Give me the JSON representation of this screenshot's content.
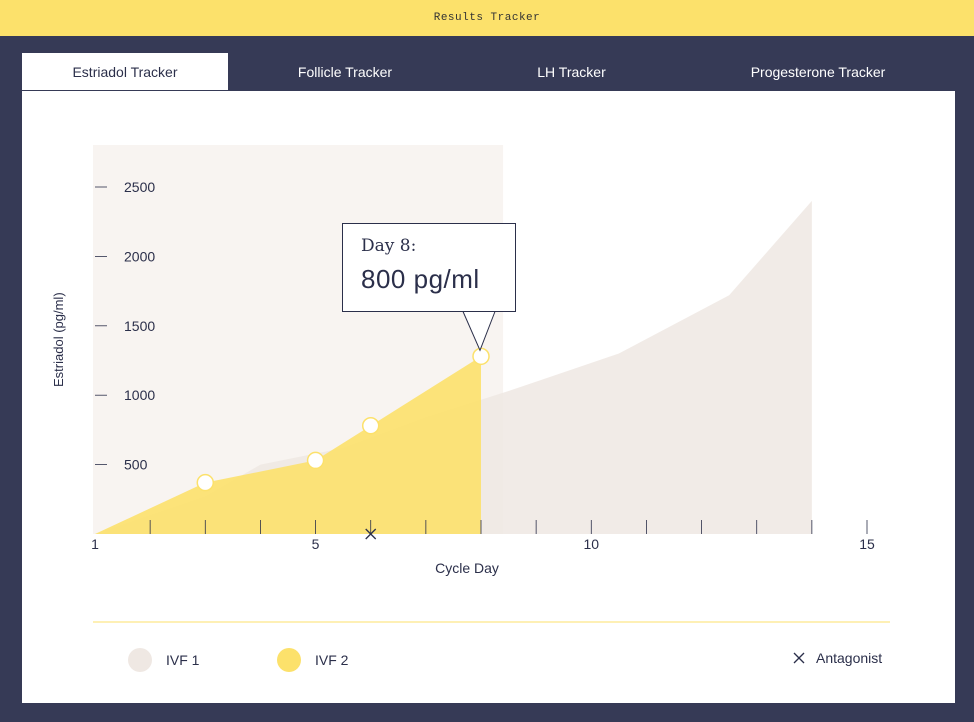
{
  "app": {
    "title": "Results Tracker"
  },
  "tabs": [
    {
      "label": "Estriadol Tracker",
      "active": true
    },
    {
      "label": "Follicle Tracker",
      "active": false
    },
    {
      "label": "LH Tracker",
      "active": false
    },
    {
      "label": "Progesterone Tracker",
      "active": false
    }
  ],
  "colors": {
    "ivf1": "#efe8e3",
    "ivf2": "#fce16b",
    "highlight_band": "#f8f4f1",
    "text": "#2b2f4a"
  },
  "tooltip": {
    "day_label": "Day 8:",
    "value_label": "800 pg/ml"
  },
  "legend": {
    "ivf1": "IVF 1",
    "ivf2": "IVF 2",
    "antagonist": "Antagonist"
  },
  "chart_data": {
    "type": "area",
    "xlabel": "Cycle Day",
    "ylabel": "Estriadol (pg/ml)",
    "xlim": [
      1,
      15
    ],
    "ylim": [
      0,
      2500
    ],
    "x_ticks": [
      1,
      5,
      10,
      15
    ],
    "y_ticks": [
      500,
      1000,
      1500,
      2000,
      2500
    ],
    "highlight_range": [
      1,
      8.4
    ],
    "series": [
      {
        "name": "IVF 1",
        "x": [
          1,
          3,
          4,
          5.5,
          7,
          8.5,
          10.5,
          12.5,
          14
        ],
        "y": [
          0,
          270,
          500,
          620,
          840,
          1030,
          1300,
          1720,
          2400
        ]
      },
      {
        "name": "IVF 2",
        "x": [
          1,
          3,
          5,
          6,
          8
        ],
        "y": [
          0,
          370,
          530,
          780,
          1280
        ]
      }
    ],
    "markers": [
      {
        "series": "IVF 2",
        "x": 3,
        "y": 370
      },
      {
        "series": "IVF 2",
        "x": 5,
        "y": 530
      },
      {
        "series": "IVF 2",
        "x": 6,
        "y": 780
      },
      {
        "series": "IVF 2",
        "x": 8,
        "y": 1280
      }
    ],
    "antagonist_day": 6,
    "tooltip_point": {
      "series": "IVF 2",
      "x": 8,
      "y": 1280
    }
  }
}
